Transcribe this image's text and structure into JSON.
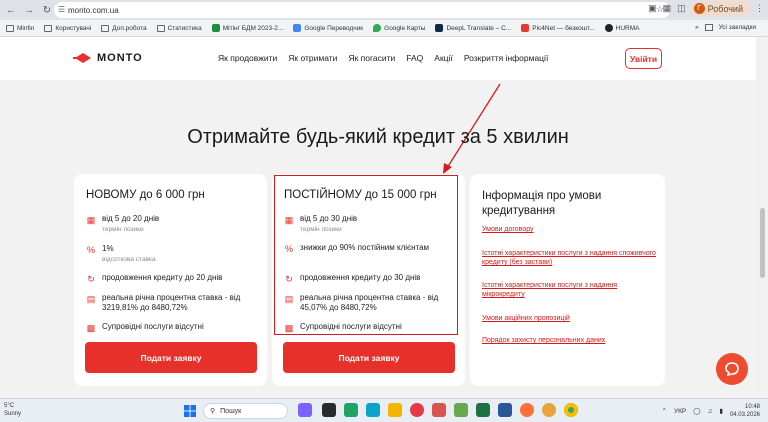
{
  "browser": {
    "url": "monto.com.ua",
    "profile_label": "Робочий",
    "profile_initial": "Г",
    "bookmarks": [
      "Minfin",
      "Користувачі",
      "Доп.робота",
      "Статистика",
      "Мітінг БДМ 2023-2...",
      "Google Переводчик",
      "Google Карты",
      "DeepL Translate – С...",
      "Pic4Net — безкошт...",
      "HURMA"
    ],
    "bookmarks_right": "Усі закладки"
  },
  "site": {
    "logo_text": "MONTO",
    "menu": [
      "Як продовжити",
      "Як отримати",
      "Як погасити",
      "FAQ",
      "Акції",
      "Розкриття інформації"
    ],
    "login_label": "Увійти",
    "headline": "Отримайте будь-який кредит за 5 хвилин"
  },
  "cards": [
    {
      "title": "НОВОМУ до 6 000 грн",
      "features": [
        {
          "icon": "calendar-icon",
          "text": "від 5 до 20 днів",
          "sub": "термін позики"
        },
        {
          "icon": "percent-icon",
          "text": "1%",
          "sub": "відсоткова ставка"
        },
        {
          "icon": "extend-icon",
          "text": "продовження кредиту до 20 днів",
          "sub": ""
        },
        {
          "icon": "document-icon",
          "text": "реальна річна процентна ставка - від 3219,81% до 8480,72%",
          "sub": ""
        },
        {
          "icon": "card-icon",
          "text": "Супровідні послуги відсутні",
          "sub": ""
        }
      ],
      "button": "Подати заявку"
    },
    {
      "title": "ПОСТІЙНОМУ до 15 000 грн",
      "features": [
        {
          "icon": "calendar-icon",
          "text": "від 5 до 30 днів",
          "sub": "термін позики"
        },
        {
          "icon": "percent-icon",
          "text": "знижки до 90% постійним клієнтам",
          "sub": ""
        },
        {
          "icon": "extend-icon",
          "text": "продовження кредиту до 30 днів",
          "sub": ""
        },
        {
          "icon": "document-icon",
          "text": "реальна річна процентна ставка - від 45,07% до 8480,72%",
          "sub": ""
        },
        {
          "icon": "card-icon",
          "text": "Супровідні послуги відсутні",
          "sub": ""
        }
      ],
      "button": "Подати заявку"
    }
  ],
  "info": {
    "title": "Інформація про умови кредитування",
    "links": [
      "Умови договору",
      "Істотні характеристики послуги з надання споживчого кредиту (без застави)",
      "Істотні характеристики послуги з надання мікрокредиту",
      "Умови акційних пропозицій",
      "Порядок захисту персональних даних"
    ]
  },
  "taskbar": {
    "temp": "5°C",
    "weather": "Sunny",
    "search": "Пошук",
    "lang": "УКР",
    "time": "10:48",
    "date": "04.03.2026"
  },
  "colors": {
    "accent": "#e8302a",
    "highlight": "#d81a1a"
  }
}
